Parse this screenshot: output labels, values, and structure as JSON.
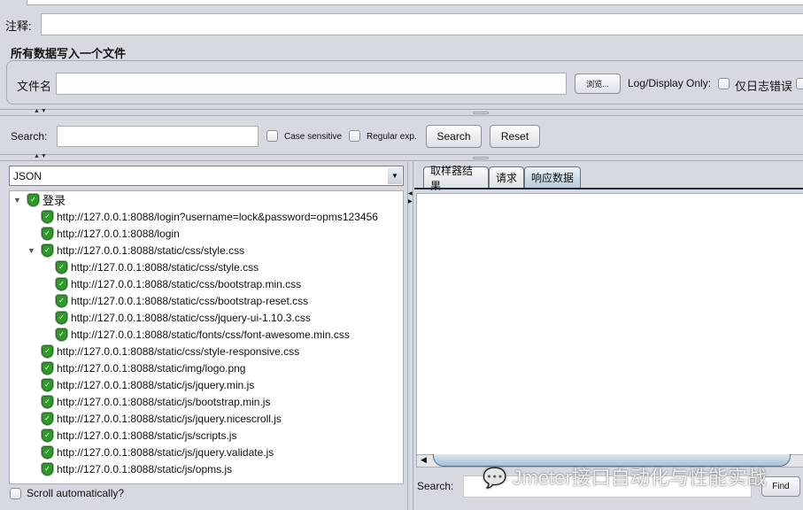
{
  "comment": {
    "label": "注释:",
    "value": ""
  },
  "write_all": {
    "title": "所有数据写入一个文件",
    "filename_label": "文件名",
    "filename_value": "",
    "browse_label": "浏览...",
    "log_display_label": "Log/Display Only:",
    "errors_only_label": "仅日志错误"
  },
  "search": {
    "label": "Search:",
    "value": "",
    "case_sensitive": "Case sensitive",
    "regex": "Regular exp.",
    "search_btn": "Search",
    "reset_btn": "Reset"
  },
  "renderer": {
    "selected": "JSON"
  },
  "tree": {
    "root": "登录",
    "items": [
      {
        "text": "http://127.0.0.1:8088/login?username=lock&password=opms123456",
        "level": 1
      },
      {
        "text": "http://127.0.0.1:8088/login",
        "level": 1
      },
      {
        "text": "http://127.0.0.1:8088/static/css/style.css",
        "level": 1,
        "expanded": true
      },
      {
        "text": "http://127.0.0.1:8088/static/css/style.css",
        "level": 2
      },
      {
        "text": "http://127.0.0.1:8088/static/css/bootstrap.min.css",
        "level": 2
      },
      {
        "text": "http://127.0.0.1:8088/static/css/bootstrap-reset.css",
        "level": 2
      },
      {
        "text": "http://127.0.0.1:8088/static/css/jquery-ui-1.10.3.css",
        "level": 2
      },
      {
        "text": "http://127.0.0.1:8088/static/fonts/css/font-awesome.min.css",
        "level": 2
      },
      {
        "text": "http://127.0.0.1:8088/static/css/style-responsive.css",
        "level": 1
      },
      {
        "text": "http://127.0.0.1:8088/static/img/logo.png",
        "level": 1
      },
      {
        "text": "http://127.0.0.1:8088/static/js/jquery.min.js",
        "level": 1
      },
      {
        "text": "http://127.0.0.1:8088/static/js/bootstrap.min.js",
        "level": 1
      },
      {
        "text": "http://127.0.0.1:8088/static/js/jquery.nicescroll.js",
        "level": 1
      },
      {
        "text": "http://127.0.0.1:8088/static/js/scripts.js",
        "level": 1
      },
      {
        "text": "http://127.0.0.1:8088/static/js/jquery.validate.js",
        "level": 1
      },
      {
        "text": "http://127.0.0.1:8088/static/js/opms.js",
        "level": 1
      }
    ]
  },
  "scroll_auto": "Scroll automatically?",
  "tabs": [
    {
      "label": "取样器结果"
    },
    {
      "label": "请求"
    },
    {
      "label": "响应数据",
      "active": true
    }
  ],
  "response": {
    "search_label": "Search:",
    "search_value": "",
    "find_label": "Find"
  },
  "watermark": "Jmeter接口自动化与性能实战",
  "colors": {
    "background": "#d6d9df",
    "success": "#2f9a2a"
  }
}
